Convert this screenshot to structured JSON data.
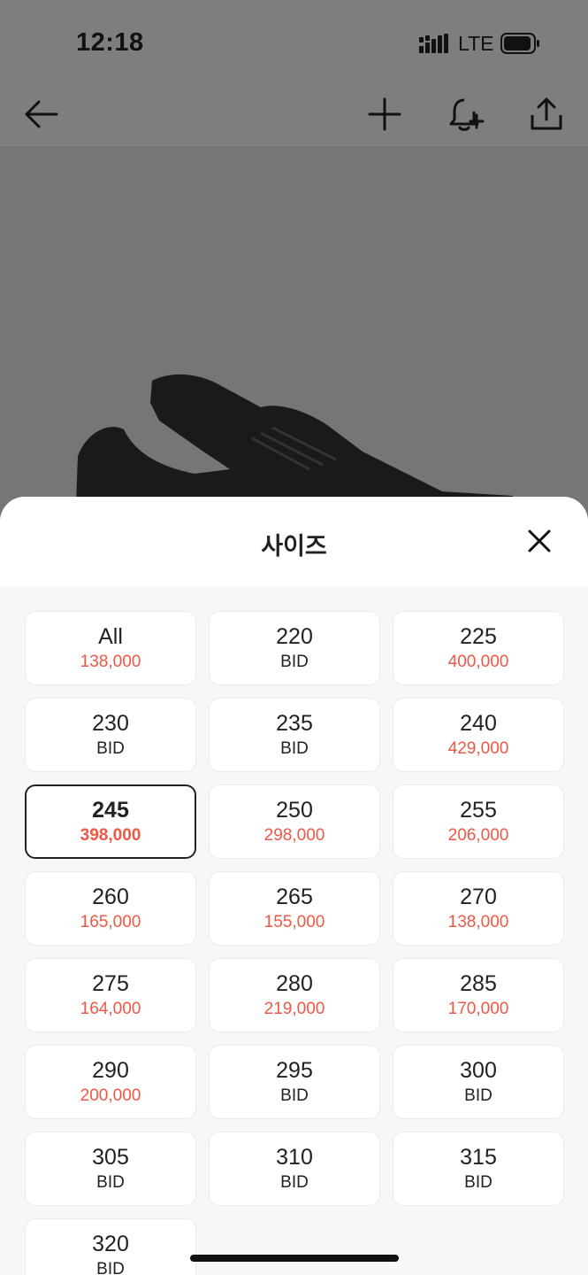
{
  "status_bar": {
    "time": "12:18",
    "network": "LTE"
  },
  "nav": {
    "icons": [
      "back-arrow-icon",
      "plus-icon",
      "bell-plus-icon",
      "share-icon"
    ]
  },
  "sheet": {
    "title": "사이즈",
    "selected": "245",
    "sizes": [
      {
        "label": "All",
        "price": "138,000",
        "bid": false
      },
      {
        "label": "220",
        "price": "BID",
        "bid": true
      },
      {
        "label": "225",
        "price": "400,000",
        "bid": false
      },
      {
        "label": "230",
        "price": "BID",
        "bid": true
      },
      {
        "label": "235",
        "price": "BID",
        "bid": true
      },
      {
        "label": "240",
        "price": "429,000",
        "bid": false
      },
      {
        "label": "245",
        "price": "398,000",
        "bid": false
      },
      {
        "label": "250",
        "price": "298,000",
        "bid": false
      },
      {
        "label": "255",
        "price": "206,000",
        "bid": false
      },
      {
        "label": "260",
        "price": "165,000",
        "bid": false
      },
      {
        "label": "265",
        "price": "155,000",
        "bid": false
      },
      {
        "label": "270",
        "price": "138,000",
        "bid": false
      },
      {
        "label": "275",
        "price": "164,000",
        "bid": false
      },
      {
        "label": "280",
        "price": "219,000",
        "bid": false
      },
      {
        "label": "285",
        "price": "170,000",
        "bid": false
      },
      {
        "label": "290",
        "price": "200,000",
        "bid": false
      },
      {
        "label": "295",
        "price": "BID",
        "bid": true
      },
      {
        "label": "300",
        "price": "BID",
        "bid": true
      },
      {
        "label": "305",
        "price": "BID",
        "bid": true
      },
      {
        "label": "310",
        "price": "BID",
        "bid": true
      },
      {
        "label": "315",
        "price": "BID",
        "bid": true
      },
      {
        "label": "320",
        "price": "BID",
        "bid": true
      }
    ]
  },
  "colors": {
    "price_red": "#f15746",
    "text_dark": "#222222",
    "overlay_gray": "#7a7a7a"
  }
}
